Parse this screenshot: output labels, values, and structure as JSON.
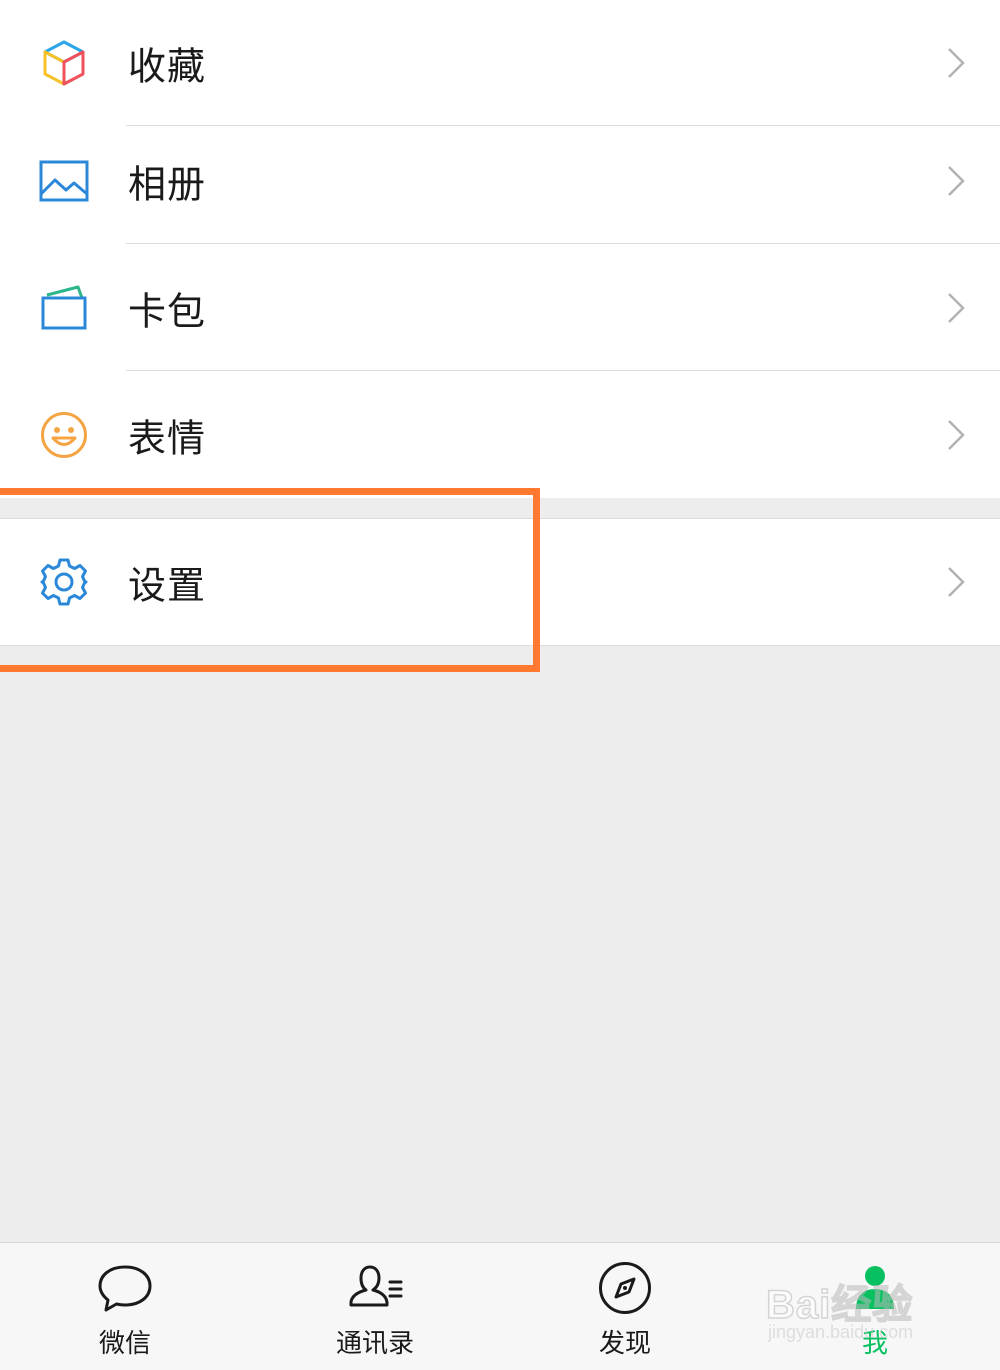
{
  "menu": {
    "items": [
      {
        "label": "收藏",
        "icon": "favorites-cube-icon"
      },
      {
        "label": "相册",
        "icon": "album-picture-icon"
      },
      {
        "label": "卡包",
        "icon": "card-wallet-icon"
      },
      {
        "label": "表情",
        "icon": "smiley-face-icon"
      }
    ],
    "settings": {
      "label": "设置",
      "icon": "gear-icon"
    }
  },
  "tabbar": {
    "tabs": [
      {
        "label": "微信",
        "icon": "chat-bubble-icon",
        "active": false
      },
      {
        "label": "通讯录",
        "icon": "contacts-icon",
        "active": false
      },
      {
        "label": "发现",
        "icon": "compass-icon",
        "active": false
      },
      {
        "label": "我",
        "icon": "me-person-icon",
        "active": true
      }
    ]
  },
  "watermark": {
    "logo": "Bai经验",
    "url": "jingyan.baidu.com"
  },
  "colors": {
    "highlight": "#ff7a30",
    "active_tab": "#07c160",
    "page_background": "#ededed"
  }
}
